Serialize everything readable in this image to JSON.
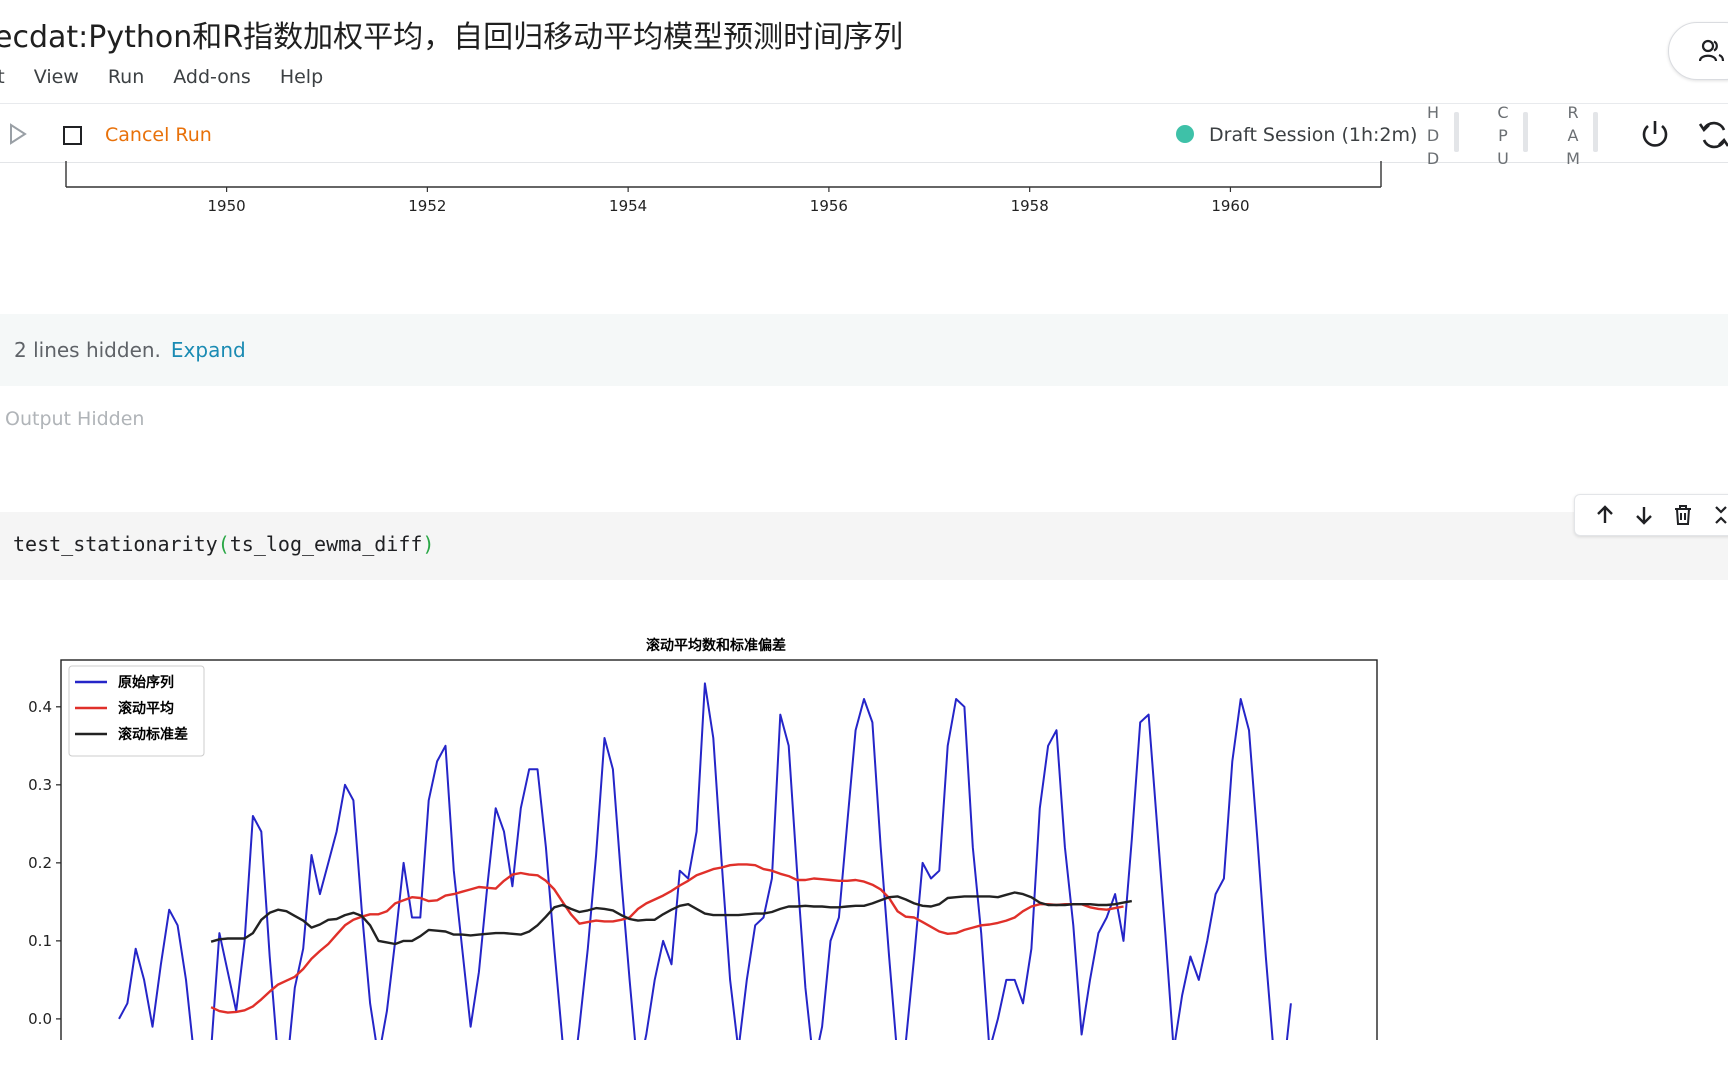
{
  "header": {
    "title": "ecdat:Python和R指数加权平均，自回归移动平均模型预测时间序列",
    "menu": [
      "it",
      "View",
      "Run",
      "Add-ons",
      "Help"
    ]
  },
  "toolbar": {
    "cancel_label": "Cancel Run",
    "session_label": "Draft Session (1h:2m)",
    "meters": [
      {
        "name": "HDD",
        "letters": [
          "H",
          "D",
          "D"
        ]
      },
      {
        "name": "CPU",
        "letters": [
          "C",
          "P",
          "U"
        ]
      },
      {
        "name": "RAM",
        "letters": [
          "R",
          "A",
          "M"
        ]
      }
    ]
  },
  "cells": {
    "hidden_text": "2 lines hidden.",
    "expand_label": "Expand",
    "output_hidden": "Output Hidden",
    "code": {
      "func": "test_stationarity",
      "open": "(",
      "arg": "ts_log_ewma_diff",
      "close": ")"
    }
  },
  "chart_data": [
    {
      "type": "line",
      "title": "",
      "x_ticks": [
        "1950",
        "1952",
        "1954",
        "1956",
        "1958",
        "1960"
      ],
      "x_tick_values": [
        1950,
        1952,
        1954,
        1956,
        1958,
        1960
      ],
      "xlim": [
        1948.4,
        1961.5
      ],
      "series": []
    },
    {
      "type": "line",
      "title": "滚动平均数和标准偏差",
      "y_ticks": [
        "0.0",
        "0.1",
        "0.2",
        "0.3",
        "0.4"
      ],
      "y_tick_values": [
        0.0,
        0.1,
        0.2,
        0.3,
        0.4
      ],
      "ylim": [
        -0.045,
        0.46
      ],
      "legend_position": "top-left",
      "x": [
        0,
        1,
        2,
        3,
        4,
        5,
        6,
        7,
        8,
        9,
        10,
        11,
        12,
        13,
        14,
        15,
        16,
        17,
        18,
        19,
        20,
        21,
        22,
        23,
        24,
        25,
        26,
        27,
        28,
        29,
        30,
        31,
        32,
        33,
        34,
        35,
        36,
        37,
        38,
        39,
        40,
        41,
        42,
        43,
        44,
        45,
        46,
        47,
        48,
        49,
        50,
        51,
        52,
        53,
        54,
        55,
        56,
        57,
        58,
        59,
        60,
        61,
        62,
        63,
        64,
        65,
        66,
        67,
        68,
        69,
        70,
        71,
        72,
        73,
        74,
        75,
        76,
        77,
        78,
        79,
        80,
        81,
        82,
        83,
        84,
        85,
        86,
        87,
        88,
        89,
        90,
        91,
        92,
        93,
        94,
        95,
        96,
        97,
        98,
        99,
        100,
        101,
        102,
        103,
        104,
        105,
        106,
        107,
        108,
        109,
        110,
        111,
        112,
        113,
        114,
        115,
        116,
        117,
        118,
        119,
        120,
        121,
        122,
        123,
        124,
        125,
        126,
        127,
        128,
        129,
        130,
        131,
        132,
        133,
        134,
        135,
        136,
        137,
        138,
        139,
        140,
        141,
        142,
        143
      ],
      "series": [
        {
          "name": "原始序列",
          "color": "#2525c8",
          "values": [
            0.0,
            0.02,
            0.09,
            0.05,
            -0.01,
            0.07,
            0.14,
            0.12,
            0.05,
            -0.05,
            -0.1,
            -0.04,
            0.11,
            0.06,
            0.01,
            0.1,
            0.26,
            0.24,
            0.08,
            -0.05,
            -0.07,
            0.04,
            0.09,
            0.21,
            0.16,
            0.2,
            0.24,
            0.3,
            0.28,
            0.14,
            0.02,
            -0.05,
            0.01,
            0.1,
            0.2,
            0.13,
            0.13,
            0.28,
            0.33,
            0.35,
            0.19,
            0.09,
            -0.01,
            0.06,
            0.17,
            0.27,
            0.24,
            0.17,
            0.27,
            0.32,
            0.32,
            0.22,
            0.09,
            -0.03,
            -0.1,
            -0.01,
            0.09,
            0.21,
            0.36,
            0.32,
            0.18,
            0.05,
            -0.07,
            -0.02,
            0.05,
            0.1,
            0.07,
            0.19,
            0.18,
            0.24,
            0.43,
            0.36,
            0.2,
            0.05,
            -0.04,
            0.05,
            0.12,
            0.13,
            0.18,
            0.39,
            0.35,
            0.19,
            0.04,
            -0.06,
            -0.01,
            0.1,
            0.13,
            0.25,
            0.37,
            0.41,
            0.38,
            0.22,
            0.08,
            -0.05,
            -0.03,
            0.08,
            0.2,
            0.18,
            0.19,
            0.35,
            0.41,
            0.4,
            0.22,
            0.11,
            -0.04,
            0.0,
            0.05,
            0.05,
            0.02,
            0.09,
            0.27,
            0.35,
            0.37,
            0.22,
            0.12,
            -0.02,
            0.05,
            0.11,
            0.13,
            0.16,
            0.1,
            0.23,
            0.38,
            0.39,
            0.25,
            0.11,
            -0.04,
            0.03,
            0.08,
            0.05,
            0.1,
            0.16,
            0.18,
            0.33,
            0.41,
            0.37,
            0.23,
            0.08,
            -0.05,
            -0.08,
            0.02
          ]
        },
        {
          "name": "滚动平均",
          "color": "#e0302a",
          "values": [
            null,
            null,
            null,
            null,
            null,
            null,
            null,
            null,
            null,
            null,
            null,
            0.015,
            0.01,
            0.008,
            0.009,
            0.011,
            0.016,
            0.025,
            0.035,
            0.044,
            0.049,
            0.054,
            0.064,
            0.077,
            0.087,
            0.096,
            0.108,
            0.12,
            0.127,
            0.131,
            0.134,
            0.134,
            0.138,
            0.148,
            0.152,
            0.156,
            0.155,
            0.151,
            0.152,
            0.158,
            0.16,
            0.163,
            0.166,
            0.169,
            0.168,
            0.167,
            0.177,
            0.185,
            0.187,
            0.185,
            0.184,
            0.177,
            0.166,
            0.15,
            0.134,
            0.122,
            0.124,
            0.126,
            0.125,
            0.125,
            0.127,
            0.13,
            0.141,
            0.148,
            0.153,
            0.158,
            0.164,
            0.171,
            0.177,
            0.184,
            0.188,
            0.192,
            0.194,
            0.197,
            0.198,
            0.198,
            0.197,
            0.192,
            0.19,
            0.186,
            0.183,
            0.178,
            0.178,
            0.18,
            0.179,
            0.178,
            0.177,
            0.177,
            0.178,
            0.176,
            0.172,
            0.166,
            0.155,
            0.138,
            0.131,
            0.13,
            0.124,
            0.118,
            0.112,
            0.109,
            0.11,
            0.114,
            0.117,
            0.12,
            0.121,
            0.123,
            0.126,
            0.13,
            0.138,
            0.144,
            0.147,
            0.147,
            0.146,
            0.147,
            0.147,
            0.147,
            0.143,
            0.141,
            0.14,
            0.142,
            0.144
          ]
        },
        {
          "name": "滚动标准差",
          "color": "#222222",
          "values": [
            null,
            null,
            null,
            null,
            null,
            null,
            null,
            null,
            null,
            null,
            null,
            0.099,
            0.102,
            0.103,
            0.103,
            0.103,
            0.11,
            0.127,
            0.136,
            0.14,
            0.138,
            0.132,
            0.126,
            0.117,
            0.121,
            0.127,
            0.128,
            0.133,
            0.136,
            0.132,
            0.12,
            0.1,
            0.098,
            0.096,
            0.1,
            0.1,
            0.106,
            0.114,
            0.113,
            0.112,
            0.108,
            0.108,
            0.107,
            0.108,
            0.109,
            0.11,
            0.11,
            0.109,
            0.108,
            0.112,
            0.12,
            0.131,
            0.143,
            0.146,
            0.141,
            0.137,
            0.139,
            0.142,
            0.141,
            0.139,
            0.133,
            0.128,
            0.126,
            0.127,
            0.127,
            0.134,
            0.14,
            0.145,
            0.147,
            0.141,
            0.135,
            0.133,
            0.133,
            0.133,
            0.133,
            0.134,
            0.135,
            0.135,
            0.137,
            0.141,
            0.144,
            0.144,
            0.145,
            0.144,
            0.144,
            0.143,
            0.143,
            0.144,
            0.145,
            0.145,
            0.148,
            0.152,
            0.156,
            0.157,
            0.153,
            0.148,
            0.145,
            0.144,
            0.147,
            0.155,
            0.156,
            0.157,
            0.157,
            0.157,
            0.157,
            0.156,
            0.159,
            0.162,
            0.16,
            0.156,
            0.149,
            0.146,
            0.146,
            0.146,
            0.147,
            0.147,
            0.147,
            0.146,
            0.146,
            0.147,
            0.149,
            0.151
          ]
        }
      ]
    }
  ]
}
